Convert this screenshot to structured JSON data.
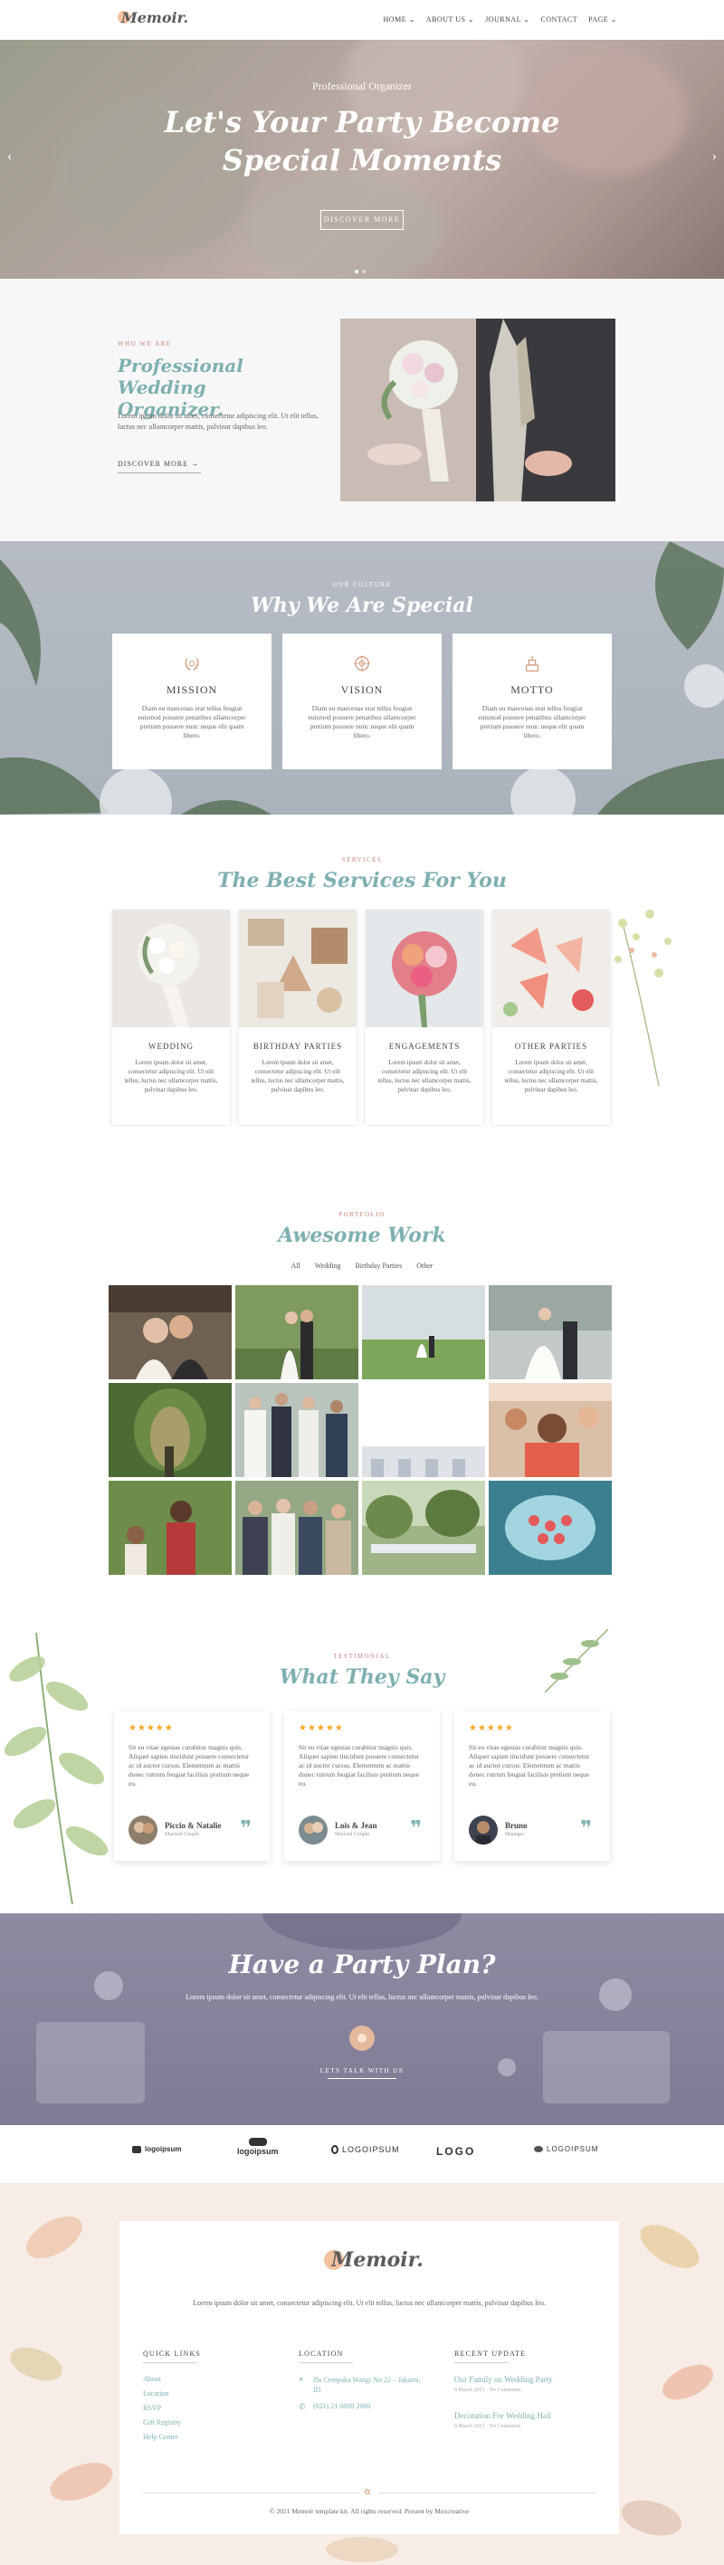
{
  "header": {
    "logo": "Memoir.",
    "nav": [
      "HOME ⌄",
      "ABOUT US ⌄",
      "JOURNAL ⌄",
      "CONTACT",
      "PAGE ⌄"
    ]
  },
  "hero": {
    "subtitle": "Professional Organizer",
    "title": "Let's Your Party Become Special Moments",
    "button": "DISCOVER MORE",
    "prev": "‹",
    "next": "›"
  },
  "about": {
    "eyebrow": "WHO WE ARE",
    "title": "Professional Wedding Organizer.",
    "text": "Lorem ipsum dolor sit amet, consectetur adipiscing elit. Ut elit tellus, luctus nec ullamcorper mattis, pulvinar dapibus leo.",
    "link": "DISCOVER MORE →"
  },
  "culture": {
    "eyebrow": "OUR CULTURE",
    "title": "Why We Are Special",
    "cards": [
      {
        "title": "MISSION",
        "text": "Diam eu maecenas erat tellus feugiat euismod posuere penatibus ullamcorper pretium posuere nunc neque elit quam libero.",
        "icon": "laurel-icon"
      },
      {
        "title": "VISION",
        "text": "Diam eu maecenas erat tellus feugiat euismod posuere penatibus ullamcorper pretium posuere nunc neque elit quam libero.",
        "icon": "mandala-icon"
      },
      {
        "title": "MOTTO",
        "text": "Diam eu maecenas erat tellus feugiat euismod posuere penatibus ullamcorper pretium posuere nunc neque elit quam libero.",
        "icon": "cake-icon"
      }
    ]
  },
  "services": {
    "eyebrow": "SERVICES",
    "title": "The Best Services For You",
    "items": [
      {
        "title": "WEDDING",
        "text": "Lorem ipsum dolor sit amet, consectetur adipiscing elit. Ut elit tellus, luctus nec ullamcorper mattis, pulvinar dapibus leo."
      },
      {
        "title": "BIRTHDAY PARTIES",
        "text": "Lorem ipsum dolor sit amet, consectetur adipiscing elit. Ut elit tellus, luctus nec ullamcorper mattis, pulvinar dapibus leo."
      },
      {
        "title": "ENGAGEMENTS",
        "text": "Lorem ipsum dolor sit amet, consectetur adipiscing elit. Ut elit tellus, luctus nec ullamcorper mattis, pulvinar dapibus leo."
      },
      {
        "title": "OTHER PARTIES",
        "text": "Lorem ipsum dolor sit amet, consectetur adipiscing elit. Ut elit tellus, luctus nec ullamcorper mattis, pulvinar dapibus leo."
      }
    ]
  },
  "portfolio": {
    "eyebrow": "PORTFOLIO",
    "title": "Awesome Work",
    "filters": [
      "All",
      "Wedding",
      "Birthday Parties",
      "Other"
    ]
  },
  "testimonial": {
    "eyebrow": "TESTIMONIAL",
    "title": "What They Say",
    "stars": "★★★★★",
    "items": [
      {
        "text": "Sit eu vitae egestas curabitur magnis quis. Aliquet sapien tincidunt posuere consectetur ac id auctor cursus. Elementum ac mattis donec rutrum feugiat facilisis pretium neque eu.",
        "name": "Piccio & Natalie",
        "role": "Married Couple"
      },
      {
        "text": "Sit eu vitae egestas curabitur magnis quis. Aliquet sapien tincidunt posuere consectetur ac id auctor cursus. Elementum ac mattis donec rutrum feugiat facilisis pretium neque eu.",
        "name": "Lois & Jean",
        "role": "Married Couple"
      },
      {
        "text": "Sit eu vitae egestas curabitur magnis quis. Aliquet sapien tincidunt posuere consectetur ac id auctor cursus. Elementum ac mattis donec rutrum feugiat facilisis pretium neque eu.",
        "name": "Bruno",
        "role": "Manager"
      }
    ]
  },
  "plan": {
    "title": "Have a Party Plan?",
    "text": "Lorem ipsum dolor sit amet, consectetur adipiscing elit. Ut elit tellus, luctus nec ullamcorper mattis, pulvinar dapibus leo.",
    "button": "LETS TALK WITH US"
  },
  "logos": [
    "logoipsum",
    "logoipsum",
    "LOGOIPSUM",
    "LOGO",
    "LOGOIPSUM"
  ],
  "footer": {
    "logo": "Memoir.",
    "text": "Lorem ipsum dolor sit amet, consectetur adipiscing elit. Ut elit tellus, luctus nec ullamcorper mattis, pulvinar dapibus leo.",
    "quick_links_title": "QUICK LINKS",
    "quick_links": [
      "About",
      "Location",
      "RSVP",
      "Gift Registry",
      "Help Center"
    ],
    "location_title": "LOCATION",
    "address": "Jln Cempaka Wangi No 22 – Jakarta, ID",
    "phone": "(021) 21 0000 2000",
    "recent_title": "RECENT UPDATE",
    "posts": [
      {
        "title": "Our Family on Wedding Party",
        "meta": "6 March 2021 · No Comments"
      },
      {
        "title": "Decoration For Wedding Hall",
        "meta": "6 March 2021 · No Comments"
      }
    ],
    "copyright": "© 2021 Memoir template kit. All rights reserved. Present by Moxcreative"
  },
  "colors": {
    "accent": "#7fb0b0",
    "peach": "#f4c29e",
    "rose": "#c9807a"
  }
}
